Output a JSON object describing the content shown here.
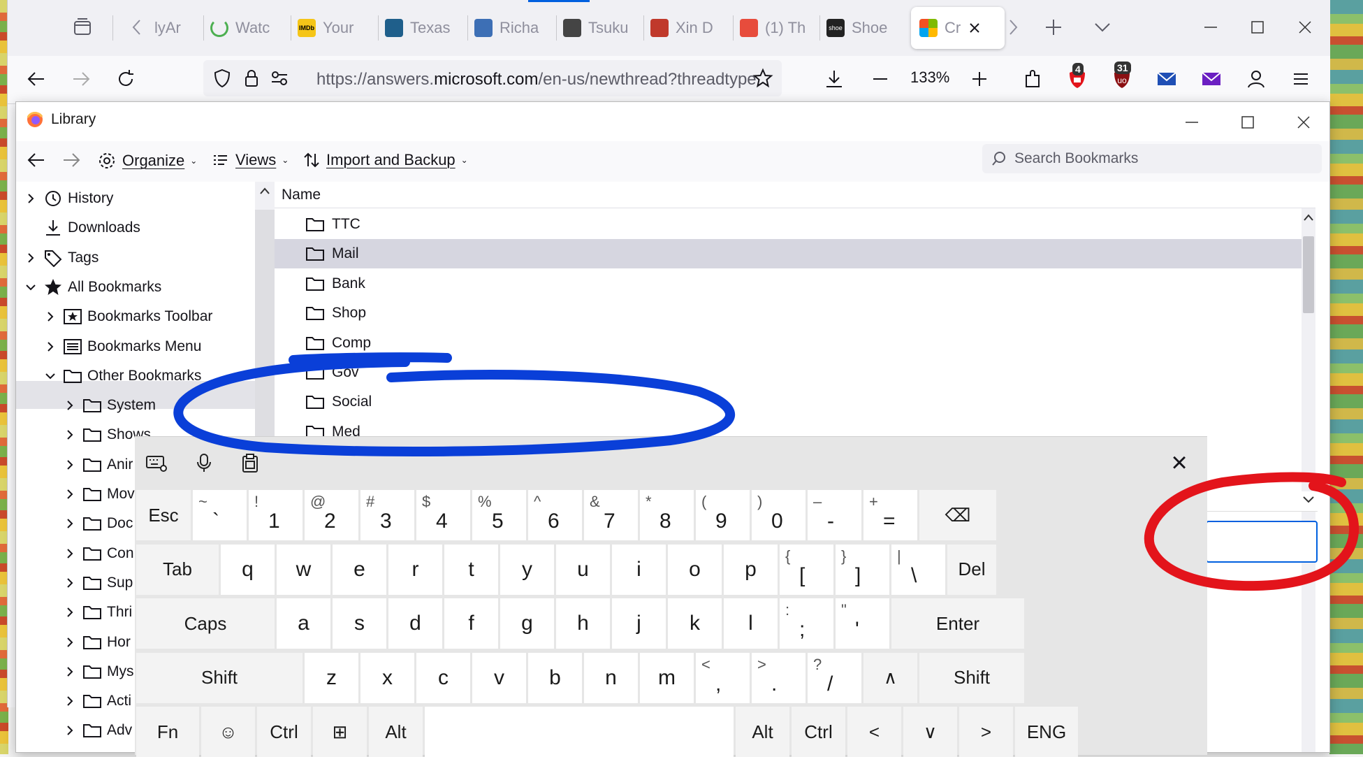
{
  "browser": {
    "tabs": [
      {
        "label": "lyAr",
        "favicon": "page-icon"
      },
      {
        "label": "Watc",
        "favicon": "loading-icon"
      },
      {
        "label": "Your",
        "favicon": "imdb-icon"
      },
      {
        "label": "Texas",
        "favicon": "site-icon"
      },
      {
        "label": "Richa",
        "favicon": "site-icon"
      },
      {
        "label": "Tsuku",
        "favicon": "site-icon"
      },
      {
        "label": "Xin D",
        "favicon": "site-icon"
      },
      {
        "label": "(1) Th",
        "favicon": "site-icon"
      },
      {
        "label": "Shoe",
        "favicon": "shoe-icon"
      },
      {
        "label": "Cr",
        "favicon": "microsoft-icon"
      }
    ],
    "imdb_text": "IMDb",
    "shoe_text": "shoe",
    "url_prefix": "https://answers.",
    "url_domain": "microsoft.com",
    "url_suffix": "/en-us/newthread?threadtype",
    "zoom": "133%",
    "badge_ublock_left": "4",
    "badge_ublock_right": "31"
  },
  "library": {
    "title": "Library",
    "toolbar": {
      "organize": "Organize",
      "views": "Views",
      "import_backup": "Import and Backup",
      "search_placeholder": "Search Bookmarks"
    },
    "sidebar": [
      {
        "label": "History",
        "icon": "clock-icon",
        "twisty": "right",
        "indent": 0
      },
      {
        "label": "Downloads",
        "icon": "download-icon",
        "twisty": "none",
        "indent": 0
      },
      {
        "label": "Tags",
        "icon": "tag-icon",
        "twisty": "right",
        "indent": 0
      },
      {
        "label": "All Bookmarks",
        "icon": "star-icon",
        "twisty": "down",
        "indent": 0
      },
      {
        "label": "Bookmarks Toolbar",
        "icon": "bookmarks-toolbar-icon",
        "twisty": "right",
        "indent": 1
      },
      {
        "label": "Bookmarks Menu",
        "icon": "bookmarks-menu-icon",
        "twisty": "right",
        "indent": 1
      },
      {
        "label": "Other Bookmarks",
        "icon": "folder-icon",
        "twisty": "down",
        "indent": 1
      },
      {
        "label": "System",
        "icon": "folder-icon",
        "twisty": "right",
        "indent": 2
      },
      {
        "label": "Shows",
        "icon": "folder-icon",
        "twisty": "right",
        "indent": 2
      },
      {
        "label": "Anir",
        "icon": "folder-icon",
        "twisty": "right",
        "indent": 2
      },
      {
        "label": "Mov",
        "icon": "folder-icon",
        "twisty": "right",
        "indent": 2
      },
      {
        "label": "Doc",
        "icon": "folder-icon",
        "twisty": "right",
        "indent": 2
      },
      {
        "label": "Con",
        "icon": "folder-icon",
        "twisty": "right",
        "indent": 2
      },
      {
        "label": "Sup",
        "icon": "folder-icon",
        "twisty": "right",
        "indent": 2
      },
      {
        "label": "Thri",
        "icon": "folder-icon",
        "twisty": "right",
        "indent": 2
      },
      {
        "label": "Hor",
        "icon": "folder-icon",
        "twisty": "right",
        "indent": 2
      },
      {
        "label": "Mys",
        "icon": "folder-icon",
        "twisty": "right",
        "indent": 2
      },
      {
        "label": "Acti",
        "icon": "folder-icon",
        "twisty": "right",
        "indent": 2
      },
      {
        "label": "Adv",
        "icon": "folder-icon",
        "twisty": "right",
        "indent": 2
      }
    ],
    "column_name": "Name",
    "items": [
      "TTC",
      "Mail",
      "Bank",
      "Shop",
      "Comp",
      "Gov",
      "Social",
      "Med"
    ],
    "selected_item": "Mail"
  },
  "keyboard": {
    "rows": [
      [
        {
          "label": "Esc",
          "w": 78
        },
        {
          "label": "`",
          "shift": "~"
        },
        {
          "label": "1",
          "shift": "!"
        },
        {
          "label": "2",
          "shift": "@"
        },
        {
          "label": "3",
          "shift": "#"
        },
        {
          "label": "4",
          "shift": "$"
        },
        {
          "label": "5",
          "shift": "%"
        },
        {
          "label": "6",
          "shift": "^"
        },
        {
          "label": "7",
          "shift": "&"
        },
        {
          "label": "8",
          "shift": "*"
        },
        {
          "label": "9",
          "shift": "("
        },
        {
          "label": "0",
          "shift": ")"
        },
        {
          "label": "-",
          "shift": "–"
        },
        {
          "label": "=",
          "shift": "+"
        },
        {
          "label": "⌫",
          "w": 110
        }
      ],
      [
        {
          "label": "Tab",
          "w": 118
        },
        {
          "label": "q"
        },
        {
          "label": "w"
        },
        {
          "label": "e"
        },
        {
          "label": "r"
        },
        {
          "label": "t"
        },
        {
          "label": "y"
        },
        {
          "label": "u"
        },
        {
          "label": "i"
        },
        {
          "label": "o"
        },
        {
          "label": "p"
        },
        {
          "label": "[",
          "shift": "{"
        },
        {
          "label": "]",
          "shift": "}"
        },
        {
          "label": "\\",
          "shift": "|"
        },
        {
          "label": "Del",
          "w": 70
        }
      ],
      [
        {
          "label": "Caps",
          "w": 198
        },
        {
          "label": "a"
        },
        {
          "label": "s"
        },
        {
          "label": "d"
        },
        {
          "label": "f"
        },
        {
          "label": "g"
        },
        {
          "label": "h"
        },
        {
          "label": "j"
        },
        {
          "label": "k"
        },
        {
          "label": "l"
        },
        {
          "label": ";",
          "shift": ":"
        },
        {
          "label": "'",
          "shift": "\""
        },
        {
          "label": "Enter",
          "w": 190
        }
      ],
      [
        {
          "label": "Shift",
          "w": 238
        },
        {
          "label": "z"
        },
        {
          "label": "x"
        },
        {
          "label": "c"
        },
        {
          "label": "v"
        },
        {
          "label": "b"
        },
        {
          "label": "n"
        },
        {
          "label": "m"
        },
        {
          "label": ",",
          "shift": "<"
        },
        {
          "label": ".",
          "shift": ">"
        },
        {
          "label": "/",
          "shift": "?"
        },
        {
          "label": "∧"
        },
        {
          "label": "Shift",
          "w": 150
        }
      ],
      [
        {
          "label": "Fn",
          "w": 90
        },
        {
          "label": "☺"
        },
        {
          "label": "Ctrl"
        },
        {
          "label": "⊞"
        },
        {
          "label": "Alt"
        },
        {
          "label": "",
          "w": 442
        },
        {
          "label": "Alt"
        },
        {
          "label": "Ctrl"
        },
        {
          "label": "<"
        },
        {
          "label": "∨"
        },
        {
          "label": ">"
        },
        {
          "label": "ENG",
          "w": 90
        }
      ]
    ],
    "toolbar_icons": [
      "keyboard-settings-icon",
      "microphone-icon",
      "clipboard-icon"
    ],
    "close": "×"
  },
  "annotations": {
    "blue_circle_color": "#0a3fd8",
    "red_circle_color": "#e3141b"
  }
}
